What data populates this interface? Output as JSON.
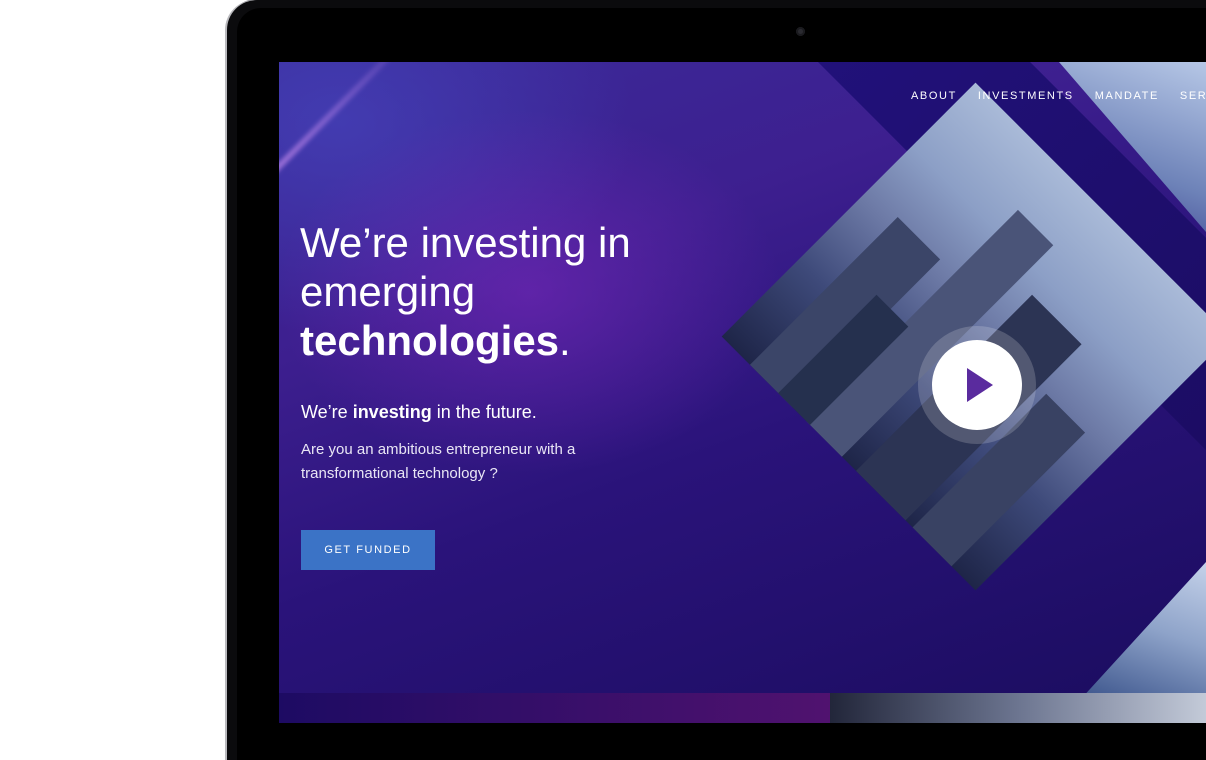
{
  "nav": {
    "items": [
      {
        "label": "ABOUT"
      },
      {
        "label": "INVESTMENTS"
      },
      {
        "label": "MANDATE"
      },
      {
        "label": "SERVICE"
      }
    ]
  },
  "hero": {
    "title_line1": "We’re investing in",
    "title_line2": "emerging",
    "title_strong": "technologies",
    "title_end": ".",
    "sub_prefix": "We’re ",
    "sub_strong": "investing",
    "sub_suffix": " in the future.",
    "description": "Are you an ambitious entrepreneur with a transformational technology ?",
    "cta_label": "GET FUNDED"
  },
  "icons": {
    "play": "play-icon"
  },
  "colors": {
    "accent_button": "#3b73c6",
    "background_purple": "#3d1f8f",
    "play_triangle": "#5a2b9e"
  }
}
